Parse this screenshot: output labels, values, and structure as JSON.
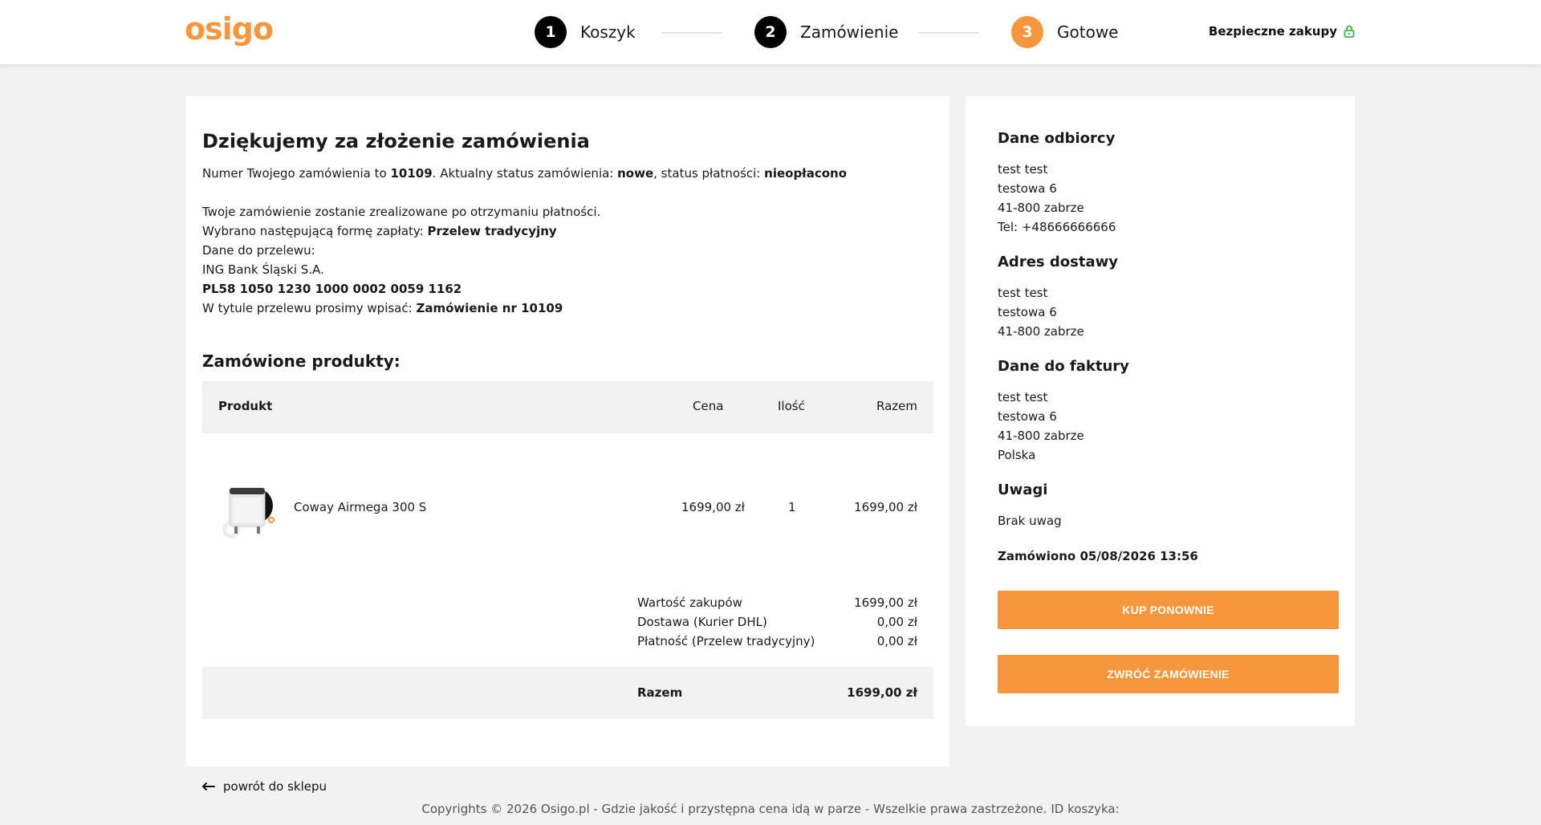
{
  "header": {
    "logo_text": "osigo",
    "steps": [
      {
        "num": "1",
        "label": "Koszyk"
      },
      {
        "num": "2",
        "label": "Zamówienie"
      },
      {
        "num": "3",
        "label": "Gotowe"
      }
    ],
    "secure_label": "Bezpieczne zakupy"
  },
  "colors": {
    "accent": "#f7963a",
    "secure_icon": "#3bb54a"
  },
  "confirmation": {
    "title": "Dziękujemy za złożenie zamówienia",
    "line1_a": "Numer Twojego zamówienia to ",
    "order_number": "10109",
    "line1_b": ". Aktualny status zamówienia: ",
    "order_status": "nowe",
    "line1_c": ", status płatności: ",
    "payment_status": "nieopłacono",
    "line2": "Twoje zamówienie zostanie zrealizowane po otrzymaniu płatności.",
    "line3_a": "Wybrano następującą formę zapłaty: ",
    "payment_method": "Przelew tradycyjny",
    "line4": "Dane do przelewu:",
    "bank_name": "ING Bank Śląski S.A.",
    "iban": "PL58 1050 1230 1000 0002 0059 1162",
    "line7_a": "W tytule przelewu prosimy wpisać: ",
    "transfer_title": "Zamówienie nr 10109"
  },
  "products": {
    "title": "Zamówione produkty:",
    "columns": {
      "product": "Produkt",
      "price": "Cena",
      "qty": "Ilość",
      "total": "Razem"
    },
    "rows": [
      {
        "name": "Coway Airmega 300 S",
        "price": "1699,00 zł",
        "qty": "1",
        "total": "1699,00 zł"
      }
    ],
    "summary": [
      {
        "label": "Wartość zakupów",
        "value": "1699,00 zł"
      },
      {
        "label": "Dostawa (Kurier DHL)",
        "value": "0,00 zł"
      },
      {
        "label": "Płatność (Przelew tradycyjny)",
        "value": "0,00 zł"
      }
    ],
    "total_label": "Razem",
    "total_value": "1699,00 zł"
  },
  "sidebar": {
    "recipient": {
      "title": "Dane odbiorcy",
      "lines": [
        "test test",
        "testowa 6",
        "41-800 zabrze",
        "Tel: +48666666666"
      ]
    },
    "shipping": {
      "title": "Adres dostawy",
      "lines": [
        "test test",
        "testowa 6",
        "41-800 zabrze"
      ]
    },
    "invoice": {
      "title": "Dane do faktury",
      "lines": [
        "test test",
        "testowa 6",
        "41-800 zabrze",
        "Polska"
      ]
    },
    "notes": {
      "title": "Uwagi",
      "text": "Brak uwag"
    },
    "ordered_at": "Zamówiono 05/08/2026 13:56",
    "buy_again_label": "KUP PONOWNIE",
    "return_label": "ZWRÓĆ ZAMÓWIENIE"
  },
  "footer": {
    "back_label": "powrót do sklepu",
    "copyright": "Copyrights © 2026 Osigo.pl - Gdzie jakość i przystępna cena idą w parze - Wszelkie prawa zastrzeżone. ID koszyka:"
  }
}
